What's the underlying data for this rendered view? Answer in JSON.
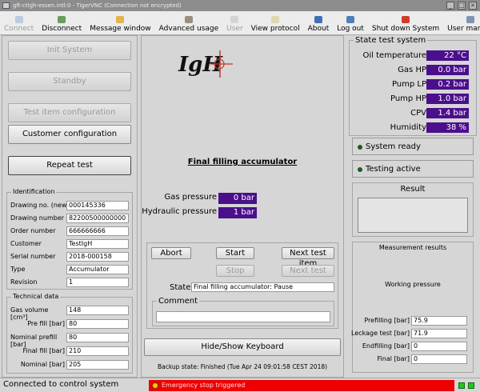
{
  "window": {
    "title": "gft-ctlgh-essen.intl:0 - TigerVNC (Connection not encrypted)"
  },
  "toolbar": [
    {
      "label": "Connect",
      "color": "#7fa3cf",
      "disabled": true
    },
    {
      "label": "Disconnect",
      "color": "#6b9c5a",
      "disabled": false
    },
    {
      "label": "Message window",
      "color": "#e2b44a",
      "disabled": false
    },
    {
      "label": "Advanced usage",
      "color": "#9a8f7a",
      "disabled": false
    },
    {
      "label": "User",
      "color": "#b7b7b7",
      "disabled": true
    },
    {
      "label": "View protocol",
      "color": "#e0d8b0",
      "disabled": false
    },
    {
      "label": "About",
      "color": "#3f6fb5",
      "disabled": false
    },
    {
      "label": "Log out",
      "color": "#4f7fb8",
      "disabled": false
    },
    {
      "label": "Shut down System",
      "color": "#d23b2c",
      "disabled": false
    },
    {
      "label": "User manual",
      "color": "#7f94b0",
      "disabled": false
    }
  ],
  "left": {
    "init_system": "Init System",
    "standby": "Standby",
    "test_item_config": "Test item configuration",
    "customer_config": "Customer configuration",
    "repeat_test": "Repeat test",
    "identification_title": "Identification",
    "identification": [
      {
        "label": "Drawing no. (new)",
        "value": "000145336"
      },
      {
        "label": "Drawing number",
        "value": "82200500000000"
      },
      {
        "label": "Order number",
        "value": "666666666"
      },
      {
        "label": "Customer",
        "value": "TestIgH"
      },
      {
        "label": "Serial number",
        "value": "2018-000158"
      },
      {
        "label": "Type",
        "value": "Accumulator"
      },
      {
        "label": "Revision",
        "value": "1"
      }
    ],
    "technical_title": "Technical data",
    "technical": [
      {
        "label": "Gas volume [cm³]",
        "value": "148"
      },
      {
        "label": "Pre fill [bar]",
        "value": "80"
      },
      {
        "label": "Nominal prefill [bar]",
        "value": "80"
      },
      {
        "label": "Final fill [bar]",
        "value": "210"
      },
      {
        "label": "Nominal [bar]",
        "value": "205"
      }
    ]
  },
  "center": {
    "logo_text": "IgH",
    "step_title": "Final filling accumulator",
    "pressures": [
      {
        "label": "Gas pressure",
        "value": "0 bar"
      },
      {
        "label": "Hydraulic pressure",
        "value": "1 bar"
      }
    ],
    "buttons": {
      "abort": "Abort",
      "start": "Start",
      "next_test_item": "Next test item",
      "stop": "Stop",
      "next_test": "Next test"
    },
    "state_label": "State",
    "state_value": "Final filling accumulator: Pause",
    "comment_label": "Comment",
    "keyboard_button": "Hide/Show Keyboard",
    "backup_state": "Backup state: Finished (Tue Apr 24 09:01:58 CEST 2018)"
  },
  "right": {
    "state_title": "State test system",
    "states": [
      {
        "label": "Oil temperature",
        "value": "22 °C"
      },
      {
        "label": "Gas HP",
        "value": "0.0 bar"
      },
      {
        "label": "Pump LP",
        "value": "0.2 bar"
      },
      {
        "label": "Pump HP",
        "value": "1.0 bar"
      },
      {
        "label": "CPV",
        "value": "1.4 bar"
      },
      {
        "label": "Humidity",
        "value": "38 %"
      }
    ],
    "system_ready": "System ready",
    "testing_active": "Testing active",
    "result_title": "Result",
    "measurement_title": "Measurement results",
    "working_pressure": "Working pressure",
    "measurements": [
      {
        "label": "Prefilling [bar]",
        "value": "75.9"
      },
      {
        "label": "Leckage test [bar]",
        "value": "71.9"
      },
      {
        "label": "Endfilling [bar]",
        "value": "0"
      },
      {
        "label": "Final [bar]",
        "value": "0"
      }
    ]
  },
  "statusbar": {
    "connection": "Connected to control system",
    "alarm": "Emergency stop triggered"
  },
  "colors": {
    "value_bg": "#4b0f8c",
    "indicator_green": "#1b5c24",
    "alarm_red": "#ee0000",
    "ok_green": "#23c423"
  }
}
